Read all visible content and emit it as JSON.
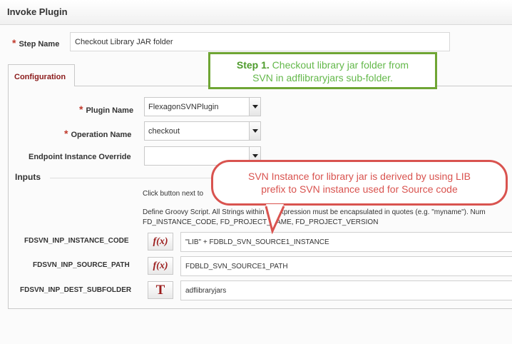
{
  "header": {
    "title": "Invoke Plugin"
  },
  "step": {
    "label": "Step Name",
    "value": "Checkout Library JAR folder"
  },
  "tabs": [
    {
      "label": "Configuration"
    }
  ],
  "plugin": {
    "label": "Plugin Name",
    "value": "FlexagonSVNPlugin"
  },
  "operation": {
    "label": "Operation Name",
    "value": "checkout"
  },
  "endpoint": {
    "label": "Endpoint Instance Override",
    "value": ""
  },
  "inputs": {
    "section_label": "Inputs",
    "help_line1": "Click button next to",
    "help_line2": "Define Groovy Script. All Strings within an expression must be encapsulated in quotes (e.g. \"myname\"). Num",
    "help_line3": "FD_INSTANCE_CODE, FD_PROJECT_NAME, FD_PROJECT_VERSION",
    "params": [
      {
        "name": "FDSVN_INP_INSTANCE_CODE",
        "button": "f(x)",
        "value": "\"LIB\" + FDBLD_SVN_SOURCE1_INSTANCE"
      },
      {
        "name": "FDSVN_INP_SOURCE_PATH",
        "button": "f(x)",
        "value": "FDBLD_SVN_SOURCE1_PATH"
      },
      {
        "name": "FDSVN_INP_DEST_SUBFOLDER",
        "button": "T",
        "value": "adflibraryjars"
      }
    ]
  },
  "callouts": {
    "step1_bold": "Step 1.",
    "step1_text_a": " Checkout library jar folder from",
    "step1_text_b": "SVN in adflibraryjars sub-folder.",
    "svn_line1": "SVN Instance for library jar is derived by using LIB",
    "svn_line2": "prefix to SVN instance used for Source code"
  },
  "colors": {
    "required_marker": "#c0392b",
    "tab_text": "#8b1a1a",
    "callout_green": "#6fa534",
    "callout_red": "#d9534f"
  },
  "icons": {
    "dropdown": "chevron-down-icon",
    "function_button": "function-icon",
    "text_button": "text-icon"
  }
}
